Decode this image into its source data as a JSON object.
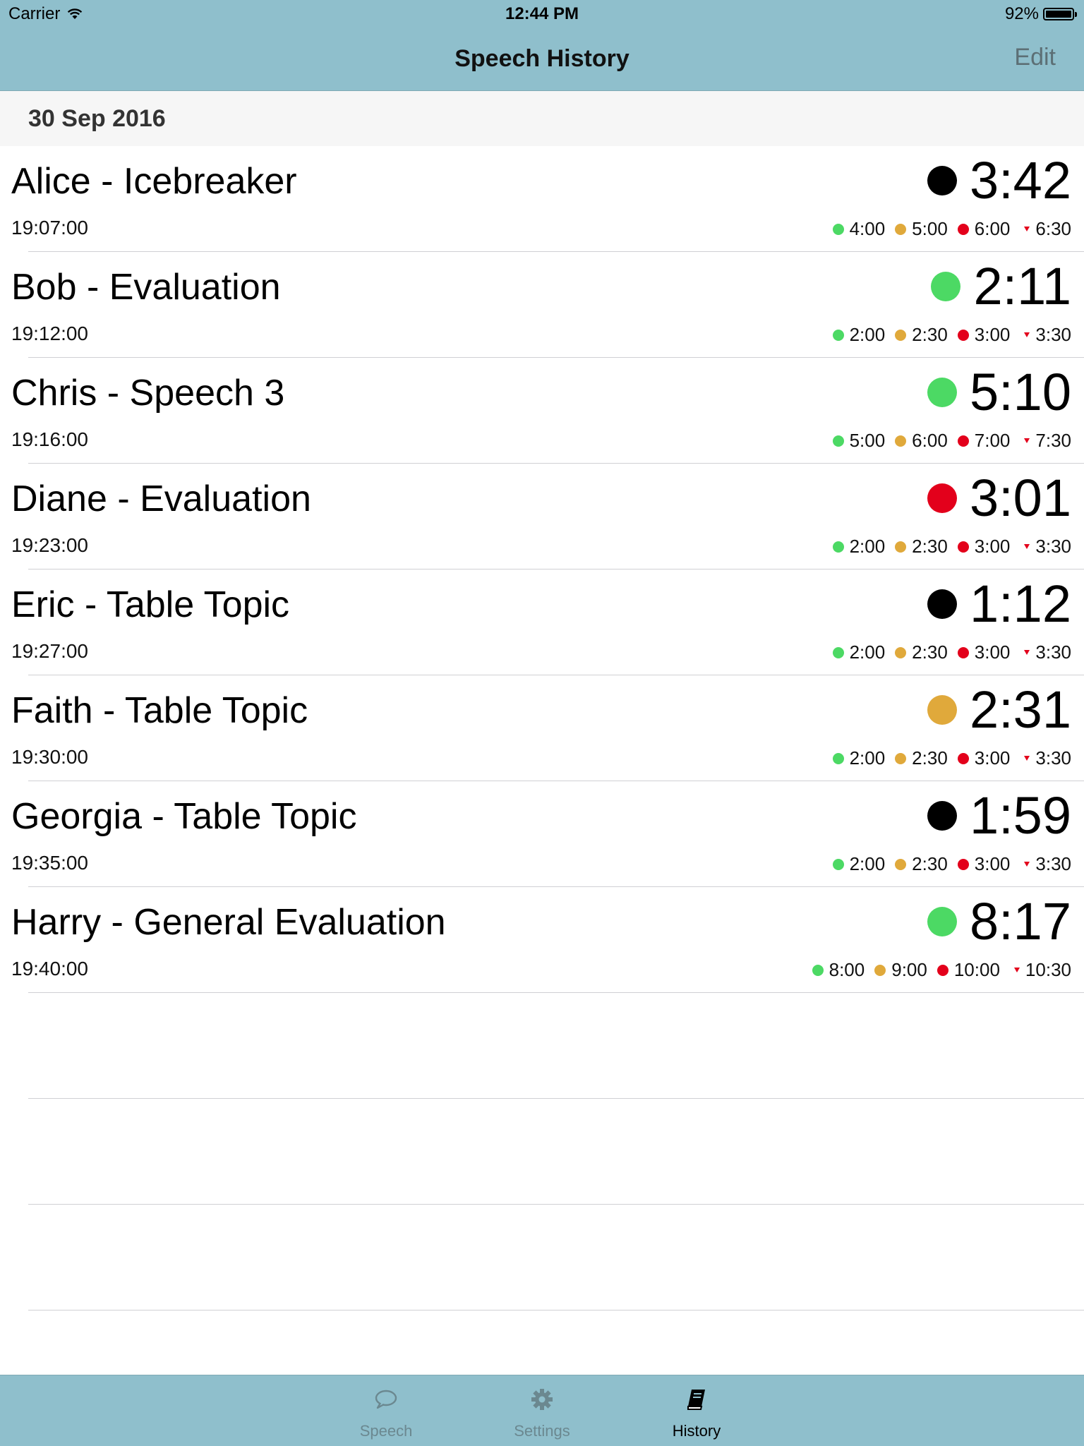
{
  "status_bar": {
    "carrier": "Carrier",
    "time": "12:44 PM",
    "battery": "92%"
  },
  "nav": {
    "title": "Speech History",
    "edit_label": "Edit"
  },
  "section": {
    "date": "30 Sep 2016"
  },
  "colors": {
    "green": "#4cd964",
    "yellow": "#e0a93b",
    "red": "#e3001b",
    "black": "#000000",
    "bar": "#8fbfcc"
  },
  "speeches": [
    {
      "name": "Alice - Icebreaker",
      "time": "19:07:00",
      "duration": "3:42",
      "status_color": "#000000",
      "thresholds": {
        "green": "4:00",
        "yellow": "5:00",
        "red": "6:00",
        "over": "6:30"
      }
    },
    {
      "name": "Bob - Evaluation",
      "time": "19:12:00",
      "duration": "2:11",
      "status_color": "#4cd964",
      "thresholds": {
        "green": "2:00",
        "yellow": "2:30",
        "red": "3:00",
        "over": "3:30"
      }
    },
    {
      "name": "Chris - Speech 3",
      "time": "19:16:00",
      "duration": "5:10",
      "status_color": "#4cd964",
      "thresholds": {
        "green": "5:00",
        "yellow": "6:00",
        "red": "7:00",
        "over": "7:30"
      }
    },
    {
      "name": "Diane - Evaluation",
      "time": "19:23:00",
      "duration": "3:01",
      "status_color": "#e3001b",
      "thresholds": {
        "green": "2:00",
        "yellow": "2:30",
        "red": "3:00",
        "over": "3:30"
      }
    },
    {
      "name": "Eric - Table Topic",
      "time": "19:27:00",
      "duration": "1:12",
      "status_color": "#000000",
      "thresholds": {
        "green": "2:00",
        "yellow": "2:30",
        "red": "3:00",
        "over": "3:30"
      }
    },
    {
      "name": "Faith - Table Topic",
      "time": "19:30:00",
      "duration": "2:31",
      "status_color": "#e0a93b",
      "thresholds": {
        "green": "2:00",
        "yellow": "2:30",
        "red": "3:00",
        "over": "3:30"
      }
    },
    {
      "name": "Georgia - Table Topic",
      "time": "19:35:00",
      "duration": "1:59",
      "status_color": "#000000",
      "thresholds": {
        "green": "2:00",
        "yellow": "2:30",
        "red": "3:00",
        "over": "3:30"
      }
    },
    {
      "name": "Harry - General Evaluation",
      "time": "19:40:00",
      "duration": "8:17",
      "status_color": "#4cd964",
      "thresholds": {
        "green": "8:00",
        "yellow": "9:00",
        "red": "10:00",
        "over": "10:30"
      }
    }
  ],
  "tabs": [
    {
      "label": "Speech",
      "icon": "speech-bubble-icon",
      "active": false
    },
    {
      "label": "Settings",
      "icon": "gear-icon",
      "active": false
    },
    {
      "label": "History",
      "icon": "book-icon",
      "active": true
    }
  ]
}
